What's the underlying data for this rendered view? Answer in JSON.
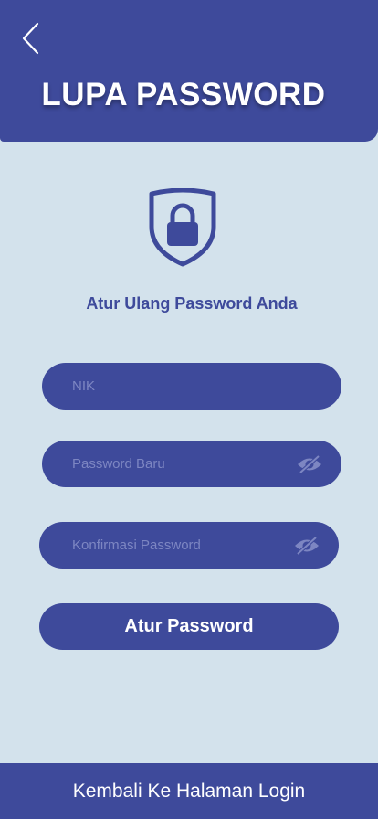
{
  "header": {
    "title": "LUPA PASSWORD"
  },
  "subtitle": "Atur Ulang Password Anda",
  "form": {
    "nik": {
      "value": "",
      "placeholder": "NIK"
    },
    "new_password": {
      "value": "",
      "placeholder": "Password Baru"
    },
    "confirm_password": {
      "value": "",
      "placeholder": "Konfirmasi Password"
    },
    "submit_label": "Atur Password"
  },
  "footer": {
    "login_link": "Kembali Ke Halaman Login"
  },
  "icons": {
    "back": "chevron-left-icon",
    "shield": "shield-lock-icon",
    "visibility": "eye-off-icon"
  },
  "colors": {
    "primary": "#3e4a9b",
    "background": "#d3e2ec",
    "placeholder": "#7d86c2",
    "text_on_primary": "#ffffff"
  }
}
